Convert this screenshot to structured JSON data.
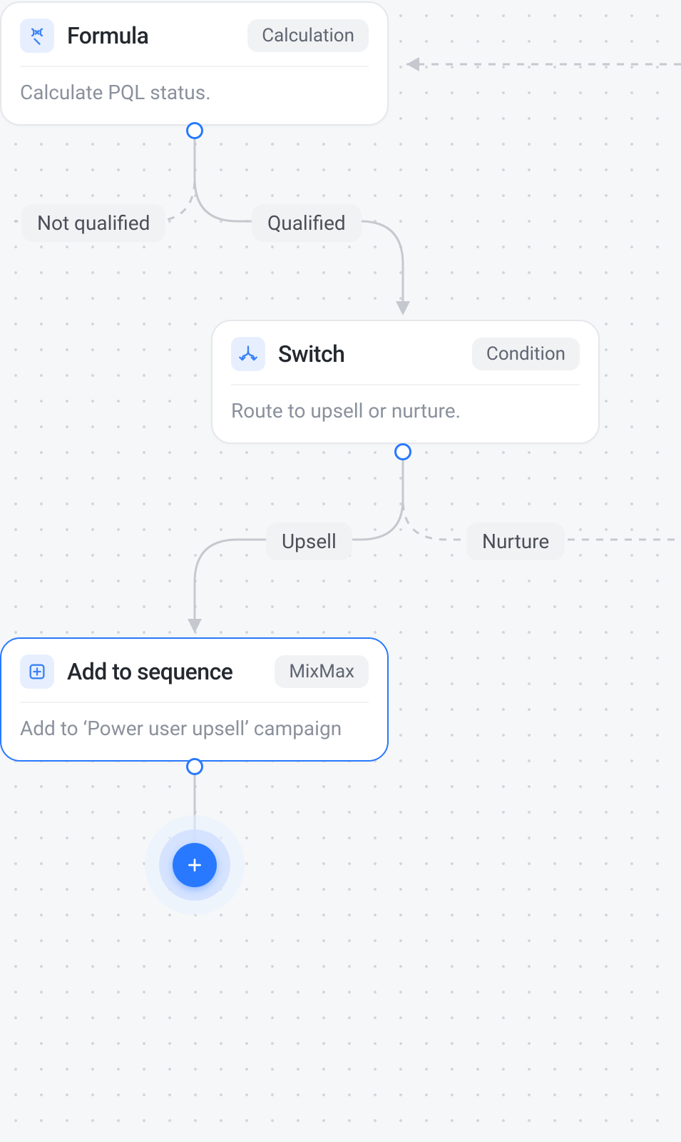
{
  "nodes": {
    "formula": {
      "title": "Formula",
      "badge": "Calculation",
      "desc": "Calculate PQL status.",
      "icon": "formula-icon"
    },
    "switch": {
      "title": "Switch",
      "badge": "Condition",
      "desc": "Route to upsell or nurture.",
      "icon": "switch-icon"
    },
    "sequence": {
      "title": "Add to sequence",
      "badge": "MixMax",
      "desc": "Add to ‘Power user upsell’ campaign",
      "icon": "add-to-sequence-icon",
      "selected": true
    }
  },
  "branches": {
    "not_qualified": "Not qualified",
    "qualified": "Qualified",
    "upsell": "Upsell",
    "nurture": "Nurture"
  },
  "add_button": {
    "name": "add-step"
  },
  "colors": {
    "accent": "#2879ff",
    "icon_bg": "#e7efff",
    "badge_bg": "#f1f2f4",
    "connector": "#c5c9cf"
  }
}
